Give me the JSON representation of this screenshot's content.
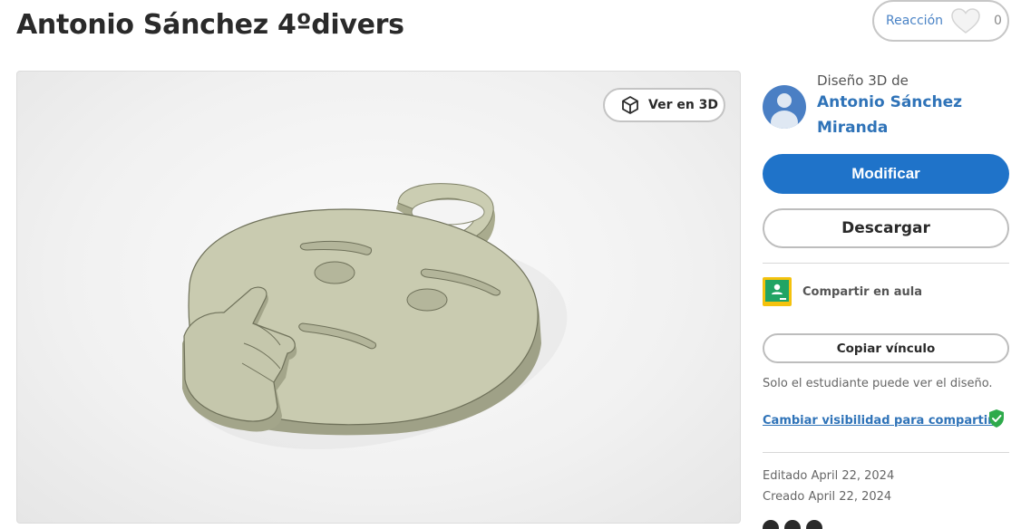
{
  "page": {
    "title": "Antonio Sánchez 4ºdivers"
  },
  "reaction": {
    "label": "Reacción",
    "count": "0",
    "icon": "heart-outline-icon"
  },
  "viewer": {
    "view3d_label": "Ver en 3D",
    "view3d_icon": "cube-icon",
    "model_color": "#c9cbb0"
  },
  "author": {
    "prefix": "Diseño 3D de",
    "name": "Antonio Sánchez Miranda",
    "avatar_icon": "user-avatar-icon"
  },
  "actions": {
    "modify_label": "Modificar",
    "download_label": "Descargar",
    "classroom_label": "Compartir en aula",
    "copy_link_label": "Copiar vínculo"
  },
  "sharing": {
    "note": "Solo el estudiante puede ver el diseño.",
    "visibility_link": "Cambiar visibilidad para compartir"
  },
  "dates": {
    "edited": "Editado April 22, 2024",
    "created": "Creado April 22, 2024"
  },
  "colors": {
    "primary": "#1f73c9",
    "link": "#2f73b8",
    "shield": "#2eaa4b"
  }
}
